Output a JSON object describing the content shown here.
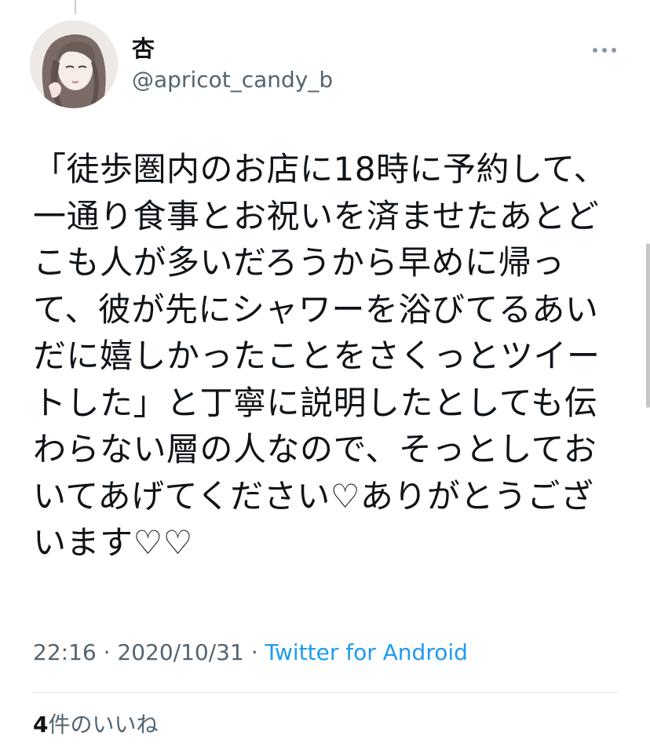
{
  "tweet": {
    "author": {
      "display_name": "杏",
      "handle": "@apricot_candy_b"
    },
    "text": "「徒歩圏内のお店に18時に予約して、\n一通り食事とお祝いを済ませたあとど\nこも人が多いだろうから早めに帰っ\nて、彼が先にシャワーを浴びてるあい\nだに嬉しかったことをさくっとツイー\nトした」と丁寧に説明したとしても伝\nわらない層の人なので、そっとしてお\nいてあげてください♡ありがとうござ\nいます♡♡",
    "time": "22:16",
    "separator": " · ",
    "date": "2020/10/31",
    "source": "Twitter for Android",
    "likes_count": "4",
    "likes_label": "件のいいね"
  },
  "icons": {
    "more": "more-horizontal-icon",
    "avatar": "avatar-illustration"
  },
  "colors": {
    "text": "#0f1419",
    "secondary": "#536471",
    "link": "#1d9bf0",
    "divider": "#e1e8ed"
  }
}
